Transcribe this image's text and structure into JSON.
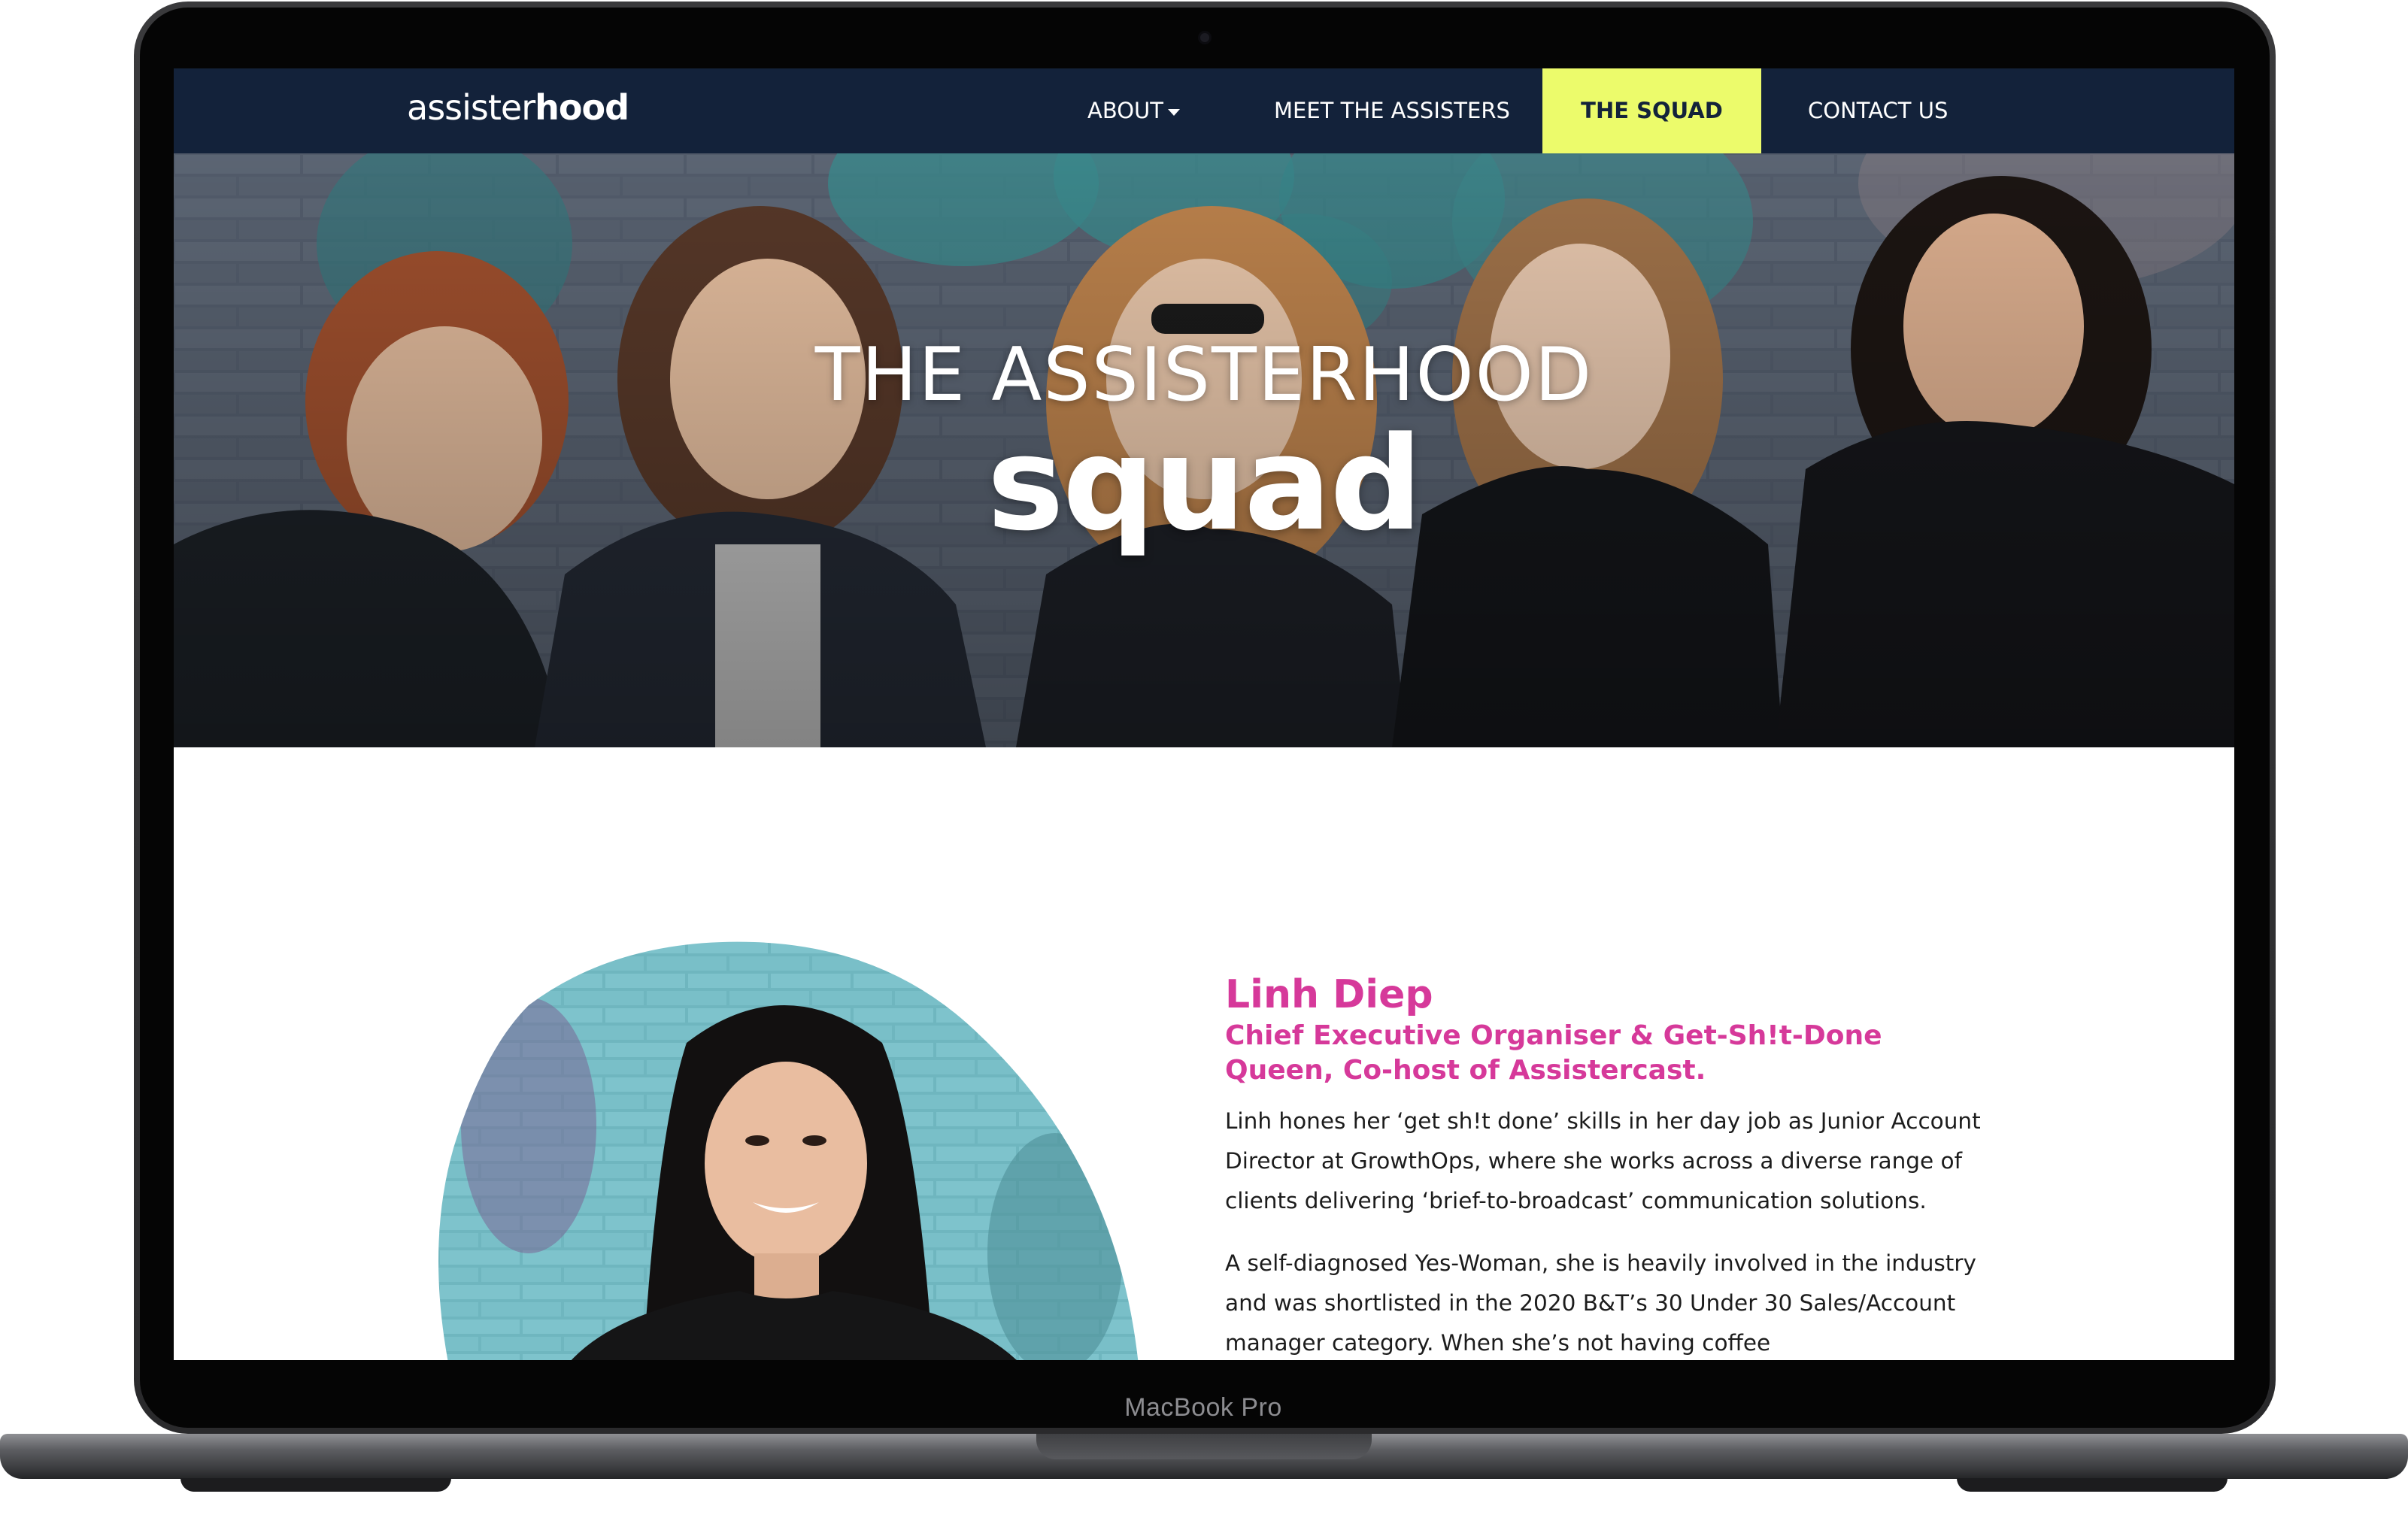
{
  "device": {
    "model_label": "MacBook Pro"
  },
  "nav": {
    "logo_light": "assister",
    "logo_bold": "hood",
    "items": [
      {
        "label": "ABOUT",
        "has_dropdown": true
      },
      {
        "label": "MEET THE ASSISTERS"
      },
      {
        "label": "THE SQUAD",
        "active": true
      },
      {
        "label": "CONTACT US"
      }
    ],
    "colors": {
      "bar": "#13223a",
      "active_bg": "#ecfb6b"
    }
  },
  "hero": {
    "title": "THE ASSISTERHOOD",
    "subtitle": "squad"
  },
  "profile": {
    "name": "Linh Diep",
    "role": "Chief Executive Organiser & Get-Sh!t-Done Queen, Co-host of Assistercast.",
    "paragraphs": [
      "Linh hones her ‘get sh!t done’ skills in her day job as Junior Account Director at GrowthOps, where she works across a diverse range of clients delivering ‘brief-to-broadcast’ communication solutions.",
      "A self-diagnosed Yes-Woman, she is heavily involved in the industry and was shortlisted in the 2020 B&T’s 30 Under 30 Sales/Account manager category. When she’s not having coffee"
    ],
    "accent_color": "#d6399a"
  }
}
